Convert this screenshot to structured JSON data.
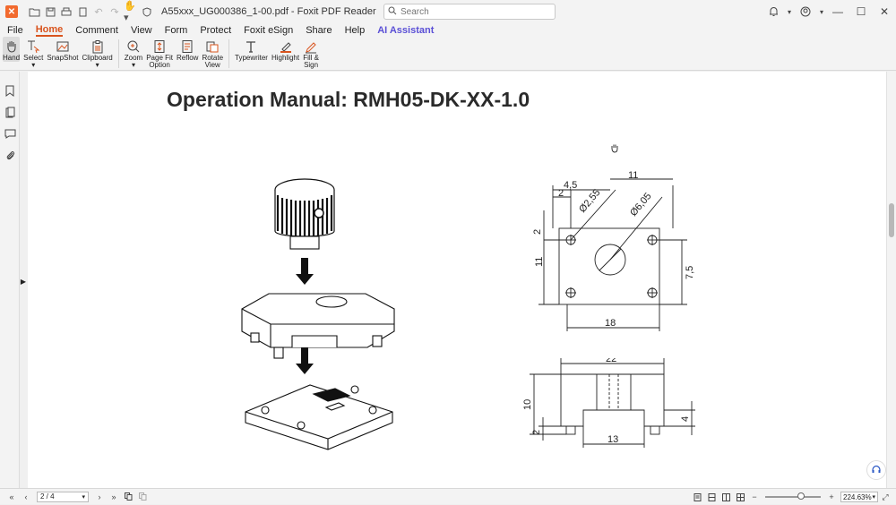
{
  "window": {
    "title": "A55xxx_UG000386_1-00.pdf - Foxit PDF Reader",
    "search_placeholder": "Search"
  },
  "menu": {
    "tabs": [
      "File",
      "Home",
      "Comment",
      "View",
      "Form",
      "Protect",
      "Foxit eSign",
      "Share",
      "Help",
      "AI Assistant"
    ],
    "active": "Home"
  },
  "ribbon": {
    "hand": "Hand",
    "select": "Select",
    "snapshot": "SnapShot",
    "clipboard": "Clipboard",
    "zoom": "Zoom",
    "page_fit_1": "Page Fit",
    "page_fit_2": "Option",
    "reflow": "Reflow",
    "rotate_1": "Rotate",
    "rotate_2": "View",
    "typewriter": "Typewriter",
    "highlight": "Highlight",
    "fill_sign_1": "Fill &",
    "fill_sign_2": "Sign"
  },
  "document": {
    "heading": "Operation Manual: RMH05-DK-XX-1.0",
    "dims_top": {
      "d45": "4,5",
      "d2a": "2",
      "d11a": "11",
      "d255": "Ø2,55",
      "d605": "Ø6,05",
      "d2b": "2",
      "d11b": "11",
      "d75": "7,5",
      "d18": "18"
    },
    "dims_side": {
      "d22": "22",
      "d10": "10",
      "d2": "2",
      "d4": "4",
      "d13": "13"
    }
  },
  "status": {
    "page": "2 / 4",
    "zoom": "224.63%"
  },
  "colors": {
    "accent": "#d9541e",
    "ai": "#5a4fd6",
    "logo": "#f26a2e"
  }
}
